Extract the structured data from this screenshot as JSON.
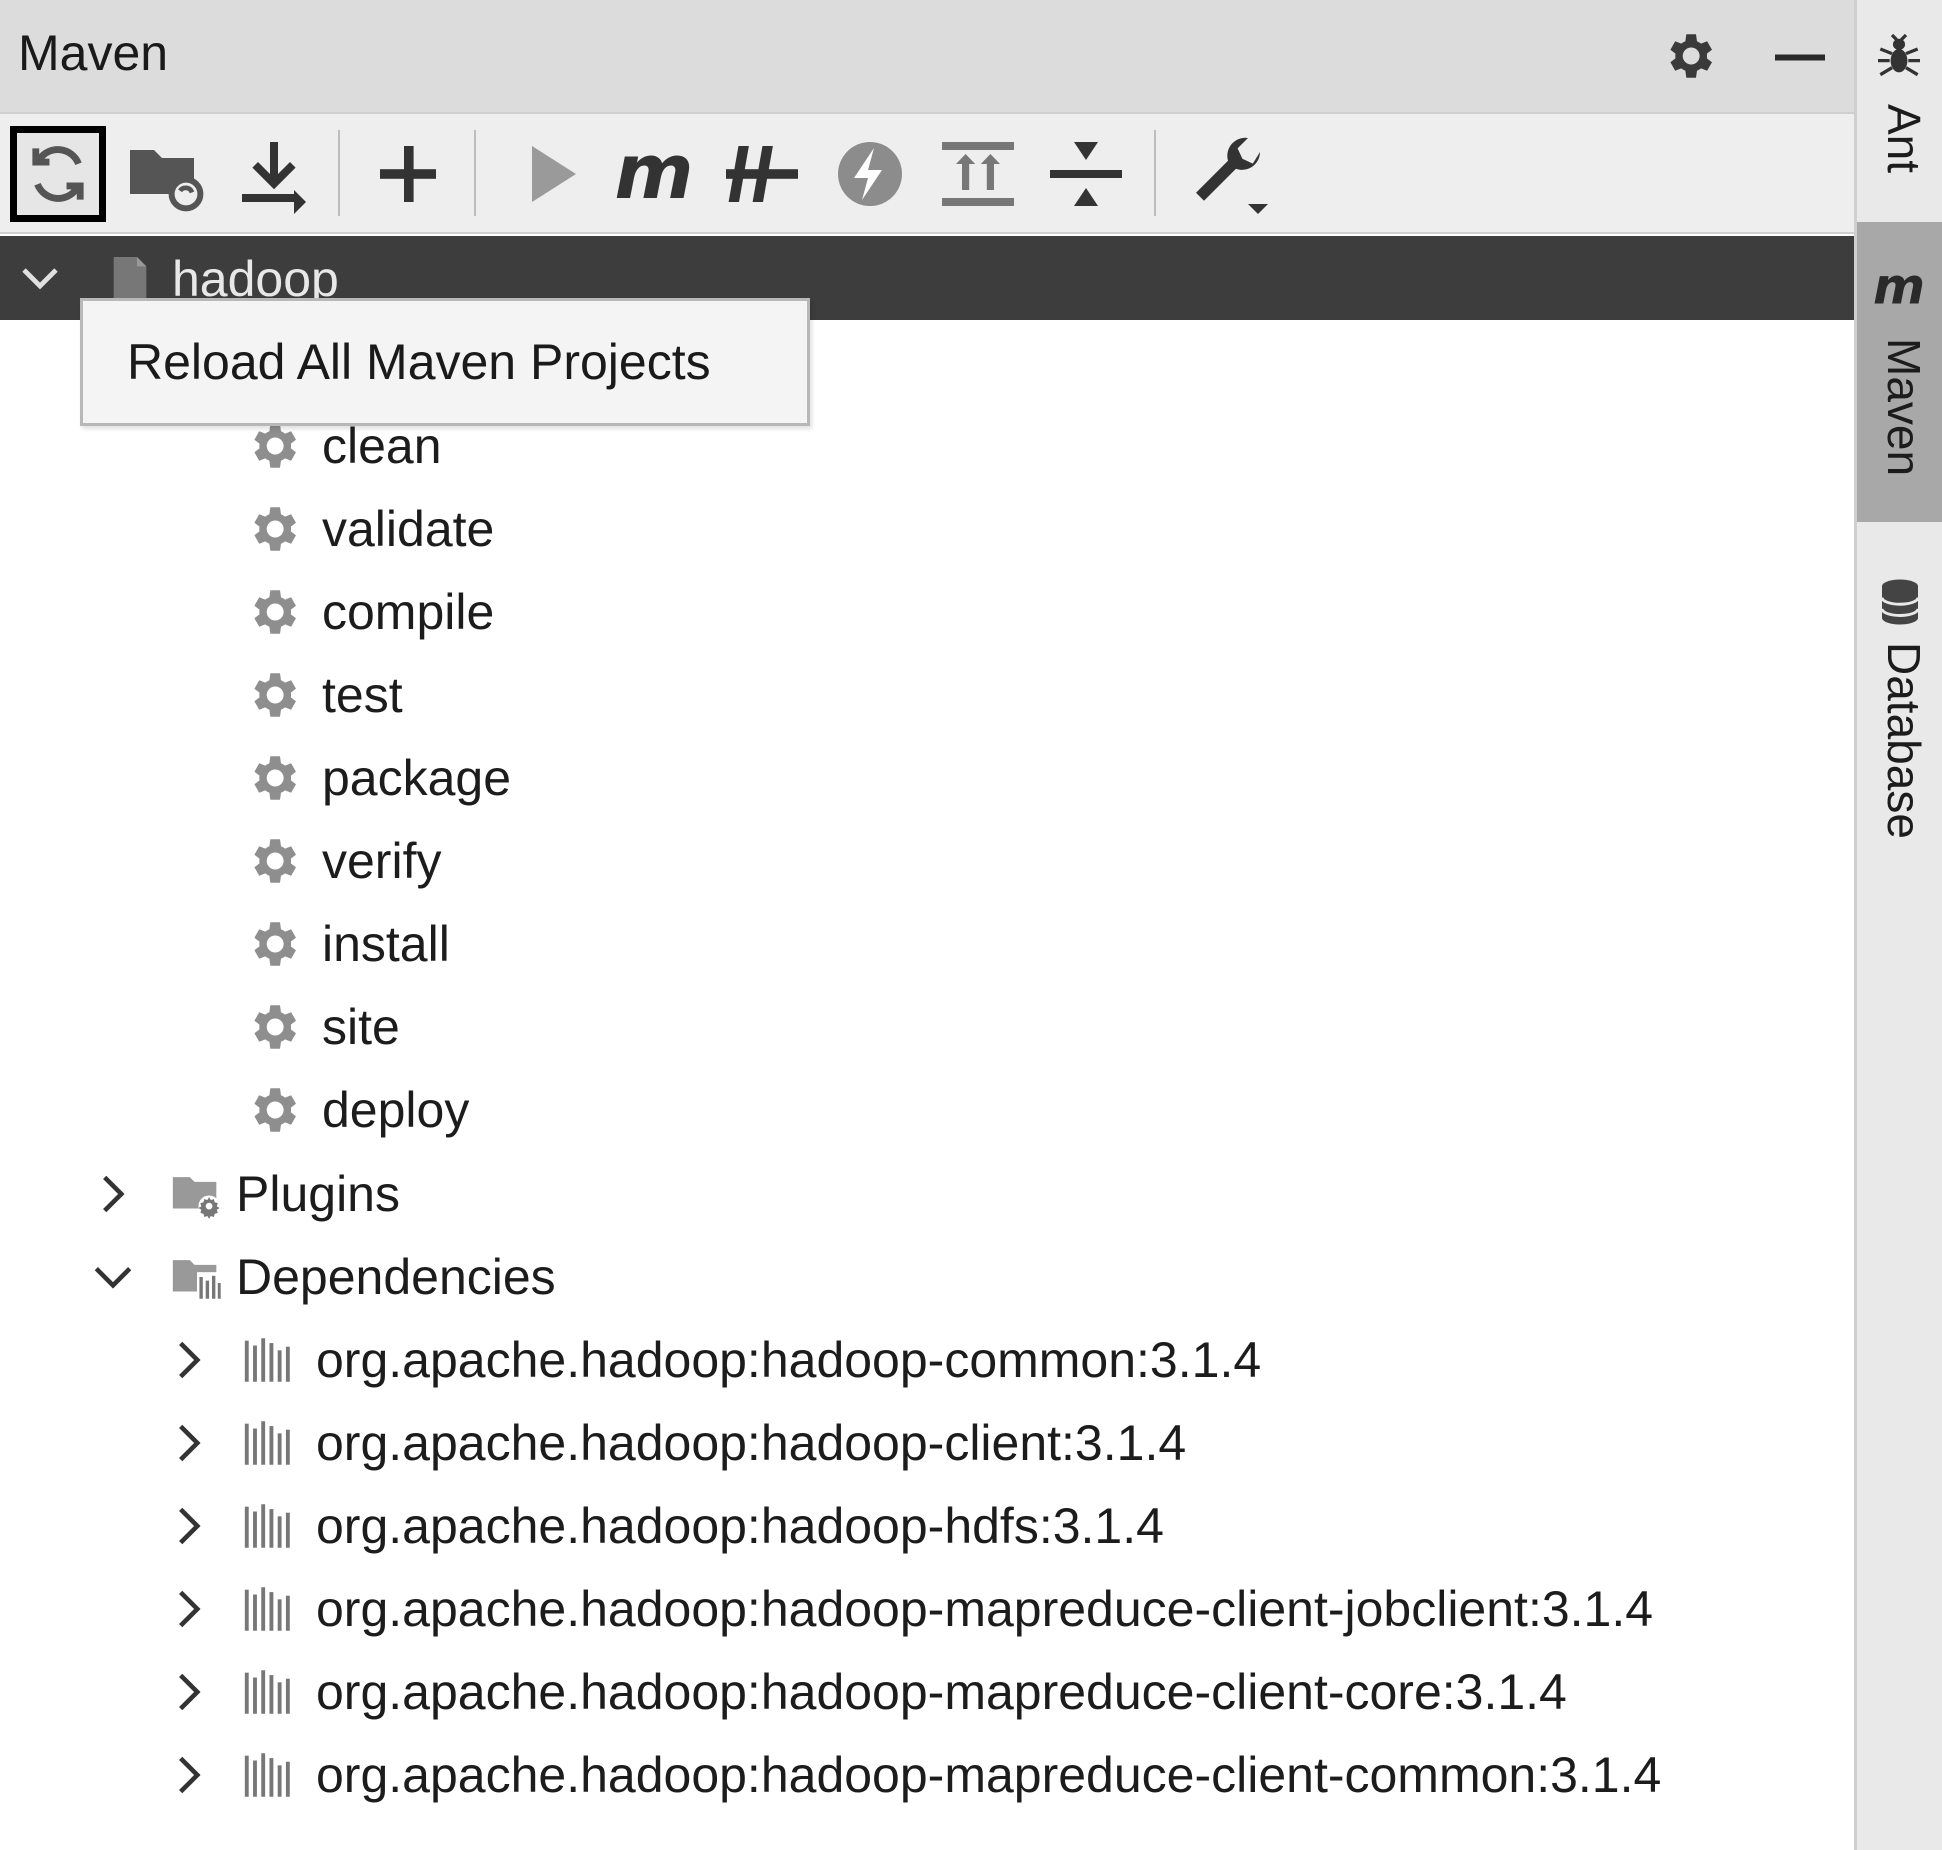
{
  "header": {
    "title": "Maven"
  },
  "toolbar": {
    "tooltip": "Reload All Maven Projects"
  },
  "tree": {
    "root": "hadoop",
    "lifecycle": [
      "clean",
      "validate",
      "compile",
      "test",
      "package",
      "verify",
      "install",
      "site",
      "deploy"
    ],
    "plugins": "Plugins",
    "dependencies": "Dependencies",
    "deps": [
      "org.apache.hadoop:hadoop-common:3.1.4",
      "org.apache.hadoop:hadoop-client:3.1.4",
      "org.apache.hadoop:hadoop-hdfs:3.1.4",
      "org.apache.hadoop:hadoop-mapreduce-client-jobclient:3.1.4",
      "org.apache.hadoop:hadoop-mapreduce-client-core:3.1.4",
      "org.apache.hadoop:hadoop-mapreduce-client-common:3.1.4"
    ]
  },
  "sidebar": {
    "ant": "Ant",
    "maven": "Maven",
    "database": "Database"
  },
  "icons": {
    "reload": "reload-icon",
    "add-folder": "folder-refresh-icon",
    "download": "download-icon",
    "add": "plus-icon",
    "run": "run-icon",
    "maven-goal": "maven-m-icon",
    "offline": "toggle-offline-icon",
    "skip-tests": "skip-tests-icon",
    "expand-all": "expand-all-icon",
    "collapse-all": "collapse-all-icon",
    "settings": "wrench-icon",
    "lifecycle-goal": "gear-icon",
    "dependency": "library-icon"
  },
  "colors": {
    "header": "#dcdcdc",
    "toolbar": "#eeeeee",
    "selected_row": "#3d3d3d",
    "sidebar_active": "#a8a8a8"
  }
}
